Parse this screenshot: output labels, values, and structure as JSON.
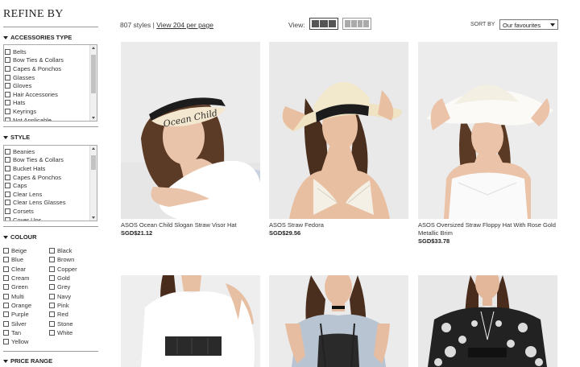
{
  "sidebar": {
    "title": "REFINE BY",
    "accessories": {
      "heading": "ACCESSORIES TYPE",
      "items": [
        "Belts",
        "Bow Ties & Collars",
        "Capes & Ponchos",
        "Glasses",
        "Gloves",
        "Hair Accessories",
        "Hats",
        "Keyrings",
        "Not Applicable"
      ]
    },
    "style": {
      "heading": "STYLE",
      "items": [
        "Beanies",
        "Bow Ties & Collars",
        "Bucket Hats",
        "Capes & Ponchos",
        "Caps",
        "Clear Lens",
        "Clear Lens Glasses",
        "Corsets",
        "Cover Ups"
      ]
    },
    "colour": {
      "heading": "COLOUR",
      "items": [
        "Beige",
        "Black",
        "Blue",
        "Brown",
        "Clear",
        "Copper",
        "Cream",
        "Gold",
        "Green",
        "Grey",
        "Multi",
        "Navy",
        "Orange",
        "Pink",
        "Purple",
        "Red",
        "Silver",
        "Stone",
        "Tan",
        "White",
        "Yellow"
      ]
    },
    "price_range": {
      "heading": "PRICE RANGE"
    }
  },
  "toolbar": {
    "styles_count": "807 styles",
    "separator": "|",
    "view_per_page": "View 204 per page",
    "view_label": "View:",
    "sort_label": "SORT BY",
    "sort_value": "Our favourites"
  },
  "products": [
    {
      "name": "ASOS Ocean Child Slogan Straw Visor Hat",
      "price": "SGD$21.12"
    },
    {
      "name": "ASOS Straw Fedora",
      "price": "SGD$29.56"
    },
    {
      "name": "ASOS Oversized Straw Floppy Hat With Rose Gold Metallic Brim",
      "price": "SGD$33.78"
    },
    {
      "name": "",
      "price": ""
    },
    {
      "name": "",
      "price": ""
    },
    {
      "name": "",
      "price": ""
    }
  ],
  "visor_text": "Ocean Child"
}
